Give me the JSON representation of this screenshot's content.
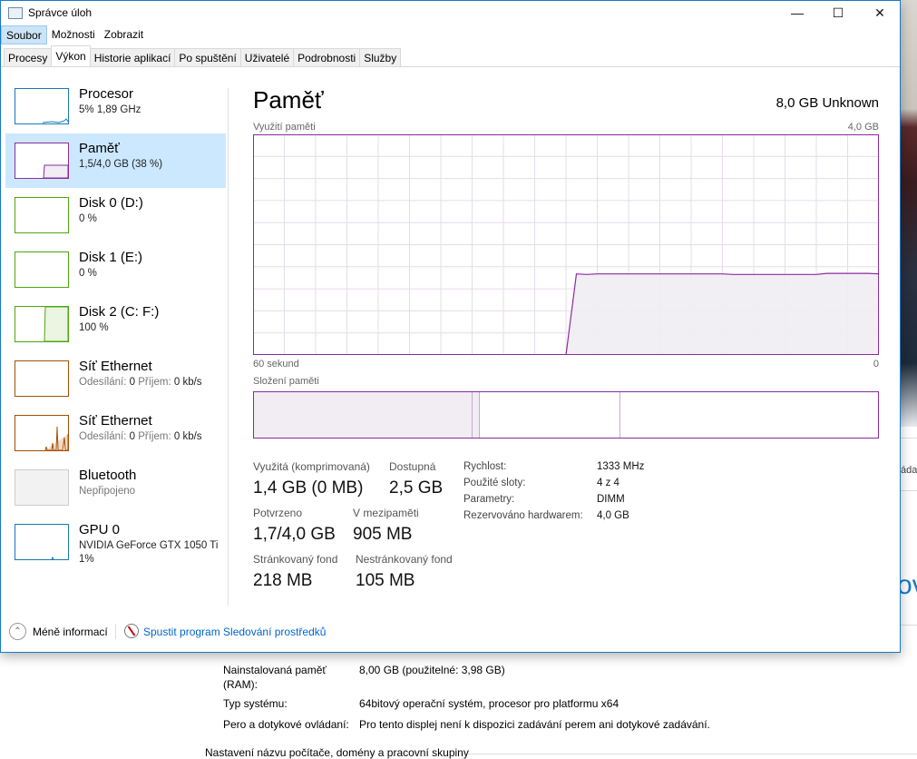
{
  "window": {
    "title": "Správce úloh"
  },
  "menu": [
    "Soubor",
    "Možnosti",
    "Zobrazit"
  ],
  "tabs": [
    "Procesy",
    "Výkon",
    "Historie aplikací",
    "Po spuštění",
    "Uživatelé",
    "Podrobnosti",
    "Služby"
  ],
  "active_tab": "Výkon",
  "sidebar": [
    {
      "name": "Procesor",
      "sub": "5% 1,89 GHz",
      "color": "#1779ba"
    },
    {
      "name": "Paměť",
      "sub": "1,5/4,0 GB (38 %)",
      "color": "#8b2a9e"
    },
    {
      "name": "Disk 0 (D:)",
      "sub": "0 %",
      "color": "#4da60c"
    },
    {
      "name": "Disk 1 (E:)",
      "sub": "0 %",
      "color": "#4da60c"
    },
    {
      "name": "Disk 2 (C: F:)",
      "sub": "100 %",
      "color": "#4da60c"
    },
    {
      "name": "Síť Ethernet",
      "sub_label1": "Odesílání:",
      "sub_val1": "0",
      "sub_label2": "Příjem:",
      "sub_val2": "0 kb/s",
      "color": "#a74f01"
    },
    {
      "name": "Síť Ethernet",
      "sub_label1": "Odesílání:",
      "sub_val1": "0",
      "sub_label2": "Příjem:",
      "sub_val2": "0 kb/s",
      "color": "#a74f01"
    },
    {
      "name": "Bluetooth",
      "sub": "Nepřipojeno",
      "color": "#bbbbbb"
    },
    {
      "name": "GPU 0",
      "sub": "NVIDIA GeForce GTX 1050 Ti",
      "sub2": "1%",
      "color": "#1779ba"
    }
  ],
  "main": {
    "title": "Paměť",
    "total": "8,0 GB Unknown",
    "usage_label": "Využití paměti",
    "usage_max": "4,0 GB",
    "axis_left": "60 sekund",
    "axis_right": "0",
    "composition_label": "Složení paměti",
    "composition": {
      "in_use": 1.4,
      "modified": 0.05,
      "standby": 0.9,
      "free": 1.65
    },
    "stats": [
      {
        "label": "Využitá (komprimovaná)",
        "value": "1,4 GB (0 MB)"
      },
      {
        "label": "Dostupná",
        "value": "2,5 GB"
      },
      {
        "label": "Potvrzeno",
        "value": "1,7/4,0 GB"
      },
      {
        "label": "V mezipaměti",
        "value": "905 MB"
      },
      {
        "label": "Stránkovaný fond",
        "value": "218 MB"
      },
      {
        "label": "Nestránkovaný fond",
        "value": "105 MB"
      }
    ],
    "details": [
      {
        "label": "Rychlost:",
        "value": "1333 MHz"
      },
      {
        "label": "Použité sloty:",
        "value": "4 z 4"
      },
      {
        "label": "Parametry:",
        "value": "DIMM"
      },
      {
        "label": "Rezervováno hardwarem:",
        "value": "4,0 GB"
      }
    ]
  },
  "chart_data": {
    "type": "area",
    "xlabel_left": "60 sekund",
    "xlabel_right": "0",
    "ylim": [
      0,
      4.0
    ],
    "unit": "GB",
    "x_seconds_ago": [
      60,
      59,
      58,
      57,
      56,
      55,
      54,
      53,
      52,
      51,
      50,
      49,
      48,
      47,
      46,
      45,
      44,
      43,
      42,
      41,
      40,
      39,
      38,
      37,
      36,
      35,
      34,
      33,
      32,
      31,
      30,
      29,
      28,
      27,
      26,
      25,
      24,
      23,
      22,
      21,
      20,
      19,
      18,
      17,
      16,
      15,
      14,
      13,
      12,
      11,
      10,
      9,
      8,
      7,
      6,
      5,
      4,
      3,
      2,
      1,
      0
    ],
    "values": [
      0,
      0,
      0,
      0,
      0,
      0,
      0,
      0,
      0,
      0,
      0,
      0,
      0,
      0,
      0,
      0,
      0,
      0,
      0,
      0,
      0,
      0,
      0,
      0,
      0,
      0,
      0,
      0,
      0,
      0,
      0,
      1.47,
      1.46,
      1.47,
      1.47,
      1.47,
      1.47,
      1.47,
      1.47,
      1.47,
      1.47,
      1.47,
      1.47,
      1.47,
      1.47,
      1.47,
      1.46,
      1.46,
      1.46,
      1.46,
      1.46,
      1.46,
      1.46,
      1.46,
      1.46,
      1.48,
      1.48,
      1.48,
      1.48,
      1.48,
      1.47
    ],
    "color": "#8b2a9e",
    "grid": true
  },
  "footer": {
    "less": "Méně informací",
    "monitor": "Spustit program Sledování prostředků"
  },
  "background": {
    "ram_label": "Nainstalovaná paměť",
    "ram_label2": "(RAM):",
    "ram_value": "8,00 GB (použitelné: 3,98 GB)",
    "type_label": "Typ systému:",
    "type_value": "64bitový operační systém, procesor pro platformu x64",
    "pen_label": "Pero a dotykové ovládaní:",
    "pen_value": "Pro tento displej není k dispozici zadávání perem ani dotykové zadávání.",
    "section": "Nastavení názvu počítače, domény a pracovní skupiny",
    "edge_text": "áda",
    "edge_big": "ov"
  }
}
